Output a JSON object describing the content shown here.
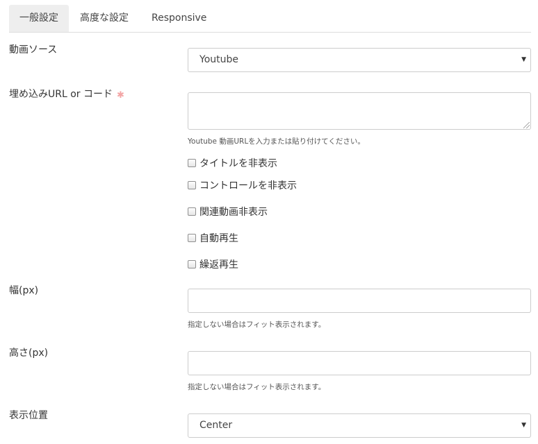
{
  "tabs": [
    {
      "label": "一般設定",
      "active": true
    },
    {
      "label": "高度な設定",
      "active": false
    },
    {
      "label": "Responsive",
      "active": false
    }
  ],
  "form": {
    "video_source": {
      "label": "動画ソース",
      "value": "Youtube"
    },
    "embed_url": {
      "label": "埋め込みURL or コード",
      "required_mark": "✱",
      "value": "",
      "help": "Youtube 動画URLを入力または貼り付けてください。"
    },
    "checkboxes": [
      {
        "label": "タイトルを非表示",
        "checked": false
      },
      {
        "label": "コントロールを非表示",
        "checked": false
      },
      {
        "label": "関連動画非表示",
        "checked": false
      },
      {
        "label": "自動再生",
        "checked": false
      },
      {
        "label": "繰返再生",
        "checked": false
      }
    ],
    "width": {
      "label": "幅(px)",
      "value": "",
      "help": "指定しない場合はフィット表示されます。"
    },
    "height": {
      "label": "高さ(px)",
      "value": "",
      "help": "指定しない場合はフィット表示されます。"
    },
    "position": {
      "label": "表示位置",
      "value": "Center"
    }
  },
  "icons": {
    "select_arrow": "caret-down-icon",
    "required": "asterisk-icon"
  }
}
